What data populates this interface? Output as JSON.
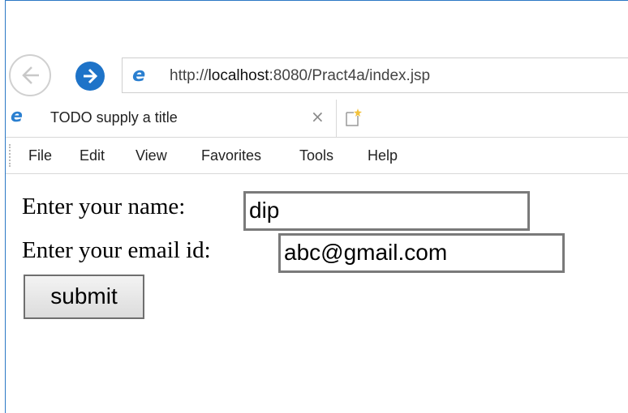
{
  "browser": {
    "address_bar": {
      "prefix": "http://",
      "host": "localhost",
      "rest": ":8080/Pract4a/index.jsp"
    },
    "tab": {
      "title": "TODO supply a title",
      "close_glyph": "×"
    },
    "menu": [
      "File",
      "Edit",
      "View",
      "Favorites",
      "Tools",
      "Help"
    ],
    "icons": {
      "back": "back-arrow-icon",
      "forward": "forward-arrow-icon",
      "site": "internet-explorer-icon",
      "new_tab": "new-tab-icon"
    },
    "colors": {
      "accent": "#1e73c8",
      "ie_icon": "#2a7fd0"
    }
  },
  "form": {
    "name_label": "Enter your name:",
    "name_value": "dip",
    "email_label": "Enter your email id:",
    "email_value": "abc@gmail.com",
    "submit_label": "submit"
  }
}
